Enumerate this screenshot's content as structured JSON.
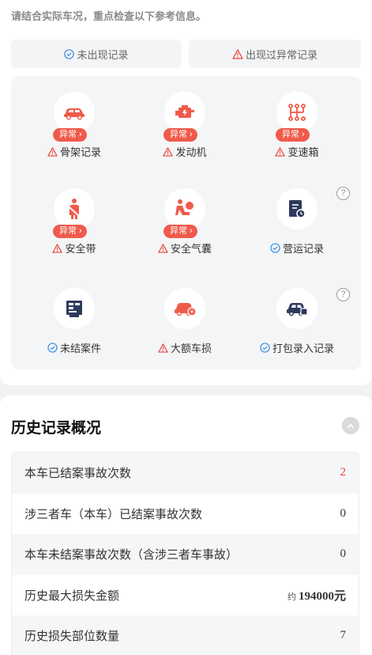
{
  "header": {
    "hint": "请结合实际车况，重点检查以下参考信息。"
  },
  "legend": {
    "no_record": "未出现记录",
    "abnormal_record": "出现过异常记录"
  },
  "badge_text": "异常",
  "items": [
    {
      "label": "骨架记录",
      "status": "abnormal",
      "icon": "car-frame-icon"
    },
    {
      "label": "发动机",
      "status": "abnormal",
      "icon": "engine-icon"
    },
    {
      "label": "变速箱",
      "status": "abnormal",
      "icon": "gearbox-icon"
    },
    {
      "label": "安全带",
      "status": "abnormal",
      "icon": "seatbelt-icon"
    },
    {
      "label": "安全气囊",
      "status": "abnormal",
      "icon": "airbag-icon"
    },
    {
      "label": "营运记录",
      "status": "normal",
      "icon": "operation-record-icon"
    },
    {
      "label": "未结案件",
      "status": "normal",
      "icon": "open-case-icon"
    },
    {
      "label": "大额车损",
      "status": "abnormal",
      "icon": "major-damage-icon"
    },
    {
      "label": "打包录入记录",
      "status": "normal",
      "icon": "package-entry-icon"
    }
  ],
  "help_mark": "?",
  "history": {
    "title": "历史记录概况",
    "rows": [
      {
        "label": "本车已结案事故次数",
        "value": "2",
        "highlight": true
      },
      {
        "label": "涉三者车（本车）已结案事故次数",
        "value": "0"
      },
      {
        "label": "本车未结案事故次数（含涉三者车事故）",
        "value": "0"
      },
      {
        "label": "历史最大损失金额",
        "prefix": "约",
        "value": "194000元"
      },
      {
        "label": "历史损失部位数量",
        "value": "7"
      }
    ]
  },
  "colors": {
    "abnormal_red": "#f05a4b",
    "normal_blue": "#3a8ee6",
    "navy_icon": "#2e3a5c"
  }
}
